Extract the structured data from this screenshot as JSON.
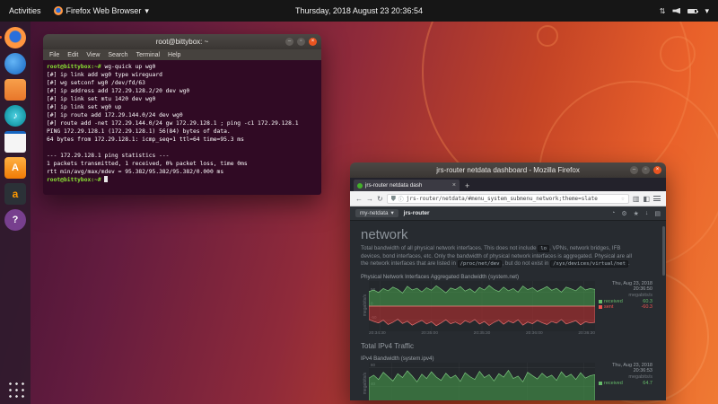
{
  "top_bar": {
    "activities": "Activities",
    "app_menu": "Firefox Web Browser",
    "clock": "Thursday, 2018 August 23  20:36:54"
  },
  "glyphs": {
    "caret": "▾",
    "updown": "⇅",
    "back": "←",
    "forward": "→",
    "reload": "↻",
    "star": "☆",
    "plus": "+",
    "close": "×",
    "info": "ⓘ",
    "library": "▥",
    "sidebar": "◧",
    "min": "–",
    "max": "▫"
  },
  "dock": {
    "items": [
      {
        "id": "firefox",
        "label": "Firefox Web Browser"
      },
      {
        "id": "thunderbird",
        "label": "Thunderbird Mail"
      },
      {
        "id": "files",
        "label": "Files"
      },
      {
        "id": "rhythmbox",
        "label": "Rhythmbox",
        "letter": "♪"
      },
      {
        "id": "libreoffice",
        "label": "LibreOffice Writer"
      },
      {
        "id": "software",
        "label": "Ubuntu Software",
        "letter": "A"
      },
      {
        "id": "amazon",
        "label": "Amazon",
        "letter": "a"
      },
      {
        "id": "help",
        "label": "Help",
        "letter": "?"
      },
      {
        "id": "show-apps",
        "label": "Show Applications"
      }
    ]
  },
  "terminal": {
    "title": "root@bittybox: ~",
    "menu": [
      "File",
      "Edit",
      "View",
      "Search",
      "Terminal",
      "Help"
    ],
    "prompt": "root@bittybox:~#",
    "lines": [
      {
        "p": 1,
        "t": "wg-quick up wg0"
      },
      {
        "t": "[#] ip link add wg0 type wireguard"
      },
      {
        "t": "[#] wg setconf wg0 /dev/fd/63"
      },
      {
        "t": "[#] ip address add 172.29.128.2/20 dev wg0"
      },
      {
        "t": "[#] ip link set mtu 1420 dev wg0"
      },
      {
        "t": "[#] ip link set wg0 up"
      },
      {
        "t": "[#] ip route add 172.29.144.0/24 dev wg0"
      },
      {
        "t": "[#] route add -net 172.29.144.0/24 gw 172.29.128.1 ; ping -c1 172.29.128.1"
      },
      {
        "t": "PING 172.29.128.1 (172.29.128.1) 56(84) bytes of data."
      },
      {
        "t": "64 bytes from 172.29.128.1: icmp_seq=1 ttl=64 time=95.3 ms"
      },
      {
        "t": ""
      },
      {
        "t": "--- 172.29.128.1 ping statistics ---"
      },
      {
        "t": "1 packets transmitted, 1 received, 0% packet loss, time 0ms"
      },
      {
        "t": "rtt min/avg/max/mdev = 95.382/95.382/95.382/0.000 ms"
      },
      {
        "p": 1,
        "t": "",
        "cursor": 1
      }
    ]
  },
  "firefox": {
    "title": "jrs-router netdata dashboard - Mozilla Firefox",
    "tab_label": "jrs-router netdata dash",
    "url": "jrs-router/netdata/#menu_system_submenu_network;theme=slate",
    "netdata": {
      "my_netdata": "my-netdata",
      "host": "jrs-router",
      "heading": "network",
      "section2": "Total IPv4 Traffic",
      "toolbar": [
        {
          "name": "alarms",
          "glyph": "◔"
        },
        {
          "name": "settings",
          "glyph": "⚙"
        },
        {
          "name": "highlight",
          "glyph": "★"
        },
        {
          "name": "import",
          "glyph": "↓"
        },
        {
          "name": "print",
          "glyph": "▤"
        }
      ],
      "description": [
        {
          "t": "Total bandwidth of all physical network interfaces. This does not include "
        },
        {
          "c": "lo"
        },
        {
          "t": ", VPNs, network bridges, IFB devices, bond interfaces, etc. Only the bandwidth of physical network interfaces is aggregated. Physical are all the network interfaces that are listed in "
        },
        {
          "c": "/proc/net/dev"
        },
        {
          "t": ", but do not exist in "
        },
        {
          "c": "/sys/devices/virtual/net"
        },
        {
          "t": "."
        }
      ]
    }
  },
  "chart_data": [
    {
      "type": "area",
      "title": "Physical Network Interfaces Aggregated Bandwidth (system.net)",
      "date": "Thu, Aug 23, 2018",
      "time": "20:36:50",
      "unit": "megabits/s",
      "ylim": [
        -90,
        90
      ],
      "yticks": [
        50,
        0,
        -50
      ],
      "x_ticks": [
        "20:34:30",
        "20:35:00",
        "20:35:30",
        "20:36:00",
        "20:36:30"
      ],
      "xfrac": [
        0.05,
        0.275,
        0.5,
        0.725,
        0.95
      ],
      "series": [
        {
          "name": "received",
          "color": "#66bb6a",
          "fill": "rgba(76,175,80,0.5)",
          "stroke": "#7bc67e",
          "legend_value": "60.3",
          "values": [
            52,
            58,
            49,
            63,
            55,
            68,
            60,
            47,
            71,
            58,
            64,
            51,
            66,
            57,
            73,
            61,
            48,
            65,
            59,
            70,
            54,
            62,
            49,
            67,
            58,
            74,
            60,
            52,
            68,
            55,
            63,
            50,
            72,
            59,
            66,
            53,
            61,
            70,
            57,
            64,
            50,
            68,
            62,
            55,
            71,
            58,
            63,
            60
          ]
        },
        {
          "name": "sent",
          "color": "#ef5350",
          "fill": "rgba(211,47,47,0.5)",
          "stroke": "#e57373",
          "legend_value": "-60.3",
          "values": [
            -48,
            -55,
            -60,
            -50,
            -66,
            -58,
            -47,
            -62,
            -54,
            -68,
            -59,
            -51,
            -64,
            -56,
            -70,
            -60,
            -49,
            -63,
            -57,
            -66,
            -52,
            -59,
            -48,
            -64,
            -55,
            -69,
            -58,
            -50,
            -65,
            -53,
            -60,
            -49,
            -68,
            -57,
            -63,
            -51,
            -59,
            -66,
            -55,
            -61,
            -48,
            -64,
            -58,
            -52,
            -67,
            -56,
            -60,
            -58
          ]
        }
      ]
    },
    {
      "type": "area",
      "title": "IPv4 Bandwidth (system.ipv4)",
      "date": "Thu, Aug 23, 2018",
      "time": "20:36:53",
      "unit": "megabits/s",
      "ylim": [
        0,
        90
      ],
      "yticks": [
        80,
        40
      ],
      "x_ticks": [],
      "xfrac": [
        0.1,
        0.4,
        0.7,
        0.95
      ],
      "series": [
        {
          "name": "received",
          "color": "#66bb6a",
          "fill": "rgba(76,175,80,0.5)",
          "stroke": "#7bc67e",
          "legend_value": "64.7",
          "values": [
            58,
            64,
            55,
            70,
            61,
            52,
            67,
            59,
            73,
            62,
            50,
            66,
            57,
            71,
            60,
            53,
            68,
            58,
            64,
            51,
            69,
            61,
            55,
            72,
            59,
            65,
            52,
            67,
            60,
            74,
            57,
            62,
            50,
            70,
            63,
            56,
            68,
            59,
            64,
            53,
            71,
            60,
            66,
            55,
            69,
            58,
            63,
            65
          ]
        }
      ]
    }
  ]
}
